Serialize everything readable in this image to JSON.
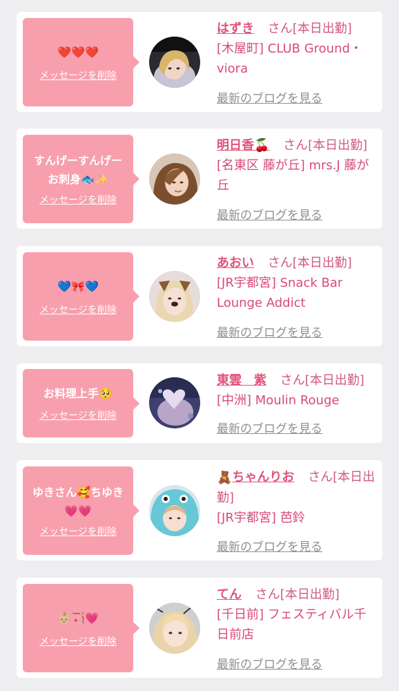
{
  "delete_label": "メッセージを削除",
  "blog_label": "最新のブログを見る",
  "colors": {
    "page_bg": "#eeeef0",
    "bubble": "#f89fad",
    "name": "#e0537a",
    "link_gray": "#8f8f8f"
  },
  "items": [
    {
      "message": "❤️❤️❤️",
      "name": "はずき",
      "name_icon": "",
      "suffix": "さん[本日出勤]",
      "shop": "[木屋町] CLUB Ground・viora",
      "avatar_icon": "avatar-photo-blonde-icon"
    },
    {
      "message": "すんげーすんげー\nお刺身🐟✨",
      "name": "明日香🍒",
      "name_icon": "",
      "suffix": "さん[本日出勤]",
      "shop": "[名東区 藤が丘] mrs.J 藤が丘",
      "avatar_icon": "avatar-photo-brown-hair-icon"
    },
    {
      "message": "💙🎀💙",
      "name": "あおい",
      "name_icon": "",
      "suffix": "さん[本日出勤]",
      "shop": "[JR宇都宮] Snack Bar Lounge Addict",
      "avatar_icon": "avatar-photo-dog-filter-icon"
    },
    {
      "message": "お料理上手🥺",
      "name": "東雲　紫",
      "name_icon": "",
      "suffix": "さん[本日出勤]",
      "shop": "[中洲] Moulin Rouge",
      "avatar_icon": "avatar-photo-heart-sticker-icon"
    },
    {
      "message": "ゆきさん🥰ちゆき\n💗💗",
      "name": "ちゃんりお",
      "name_icon": "🧸",
      "suffix": "さん[本日出勤]",
      "shop": "[JR宇都宮] 芭鈴",
      "avatar_icon": "avatar-photo-blue-hood-icon"
    },
    {
      "message": "👶🏼🏹💗",
      "name": "てん",
      "name_icon": "",
      "suffix": "さん[本日出勤]",
      "shop": "[千日前] フェスティバル千日前店",
      "avatar_icon": "avatar-photo-blonde-girl-icon"
    }
  ]
}
